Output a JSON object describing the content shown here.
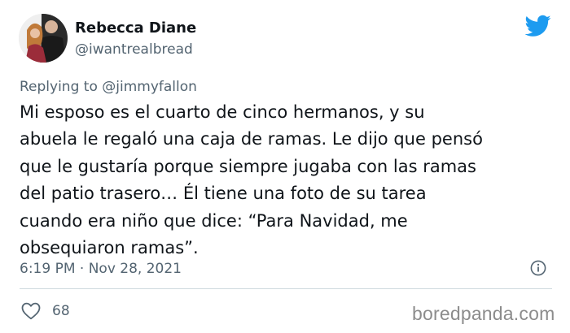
{
  "author": {
    "name": "Rebecca Diane",
    "handle": "@iwantrealbread",
    "avatar_icon": "profile-photo"
  },
  "brand": {
    "icon": "twitter-bird-icon",
    "color": "#1d9bf0"
  },
  "reply": {
    "prefix": "Replying to",
    "mention": "@jimmyfallon"
  },
  "tweet": {
    "text": "Mi esposo es el cuarto de cinco hermanos, y su\nabuela le regaló una caja de ramas. Le dijo que pensó\nque le gustaría porque siempre jugaba con las ramas\ndel patio trasero… Él tiene una foto de su tarea\ncuando era niño que dice: “Para Navidad, me\nobsequiaron ramas”."
  },
  "meta": {
    "timestamp": "6:19 PM · Nov 28, 2021",
    "info_icon": "info-icon"
  },
  "actions": {
    "like_icon": "heart-icon",
    "like_count": "68"
  },
  "watermark": "boredpanda.com"
}
